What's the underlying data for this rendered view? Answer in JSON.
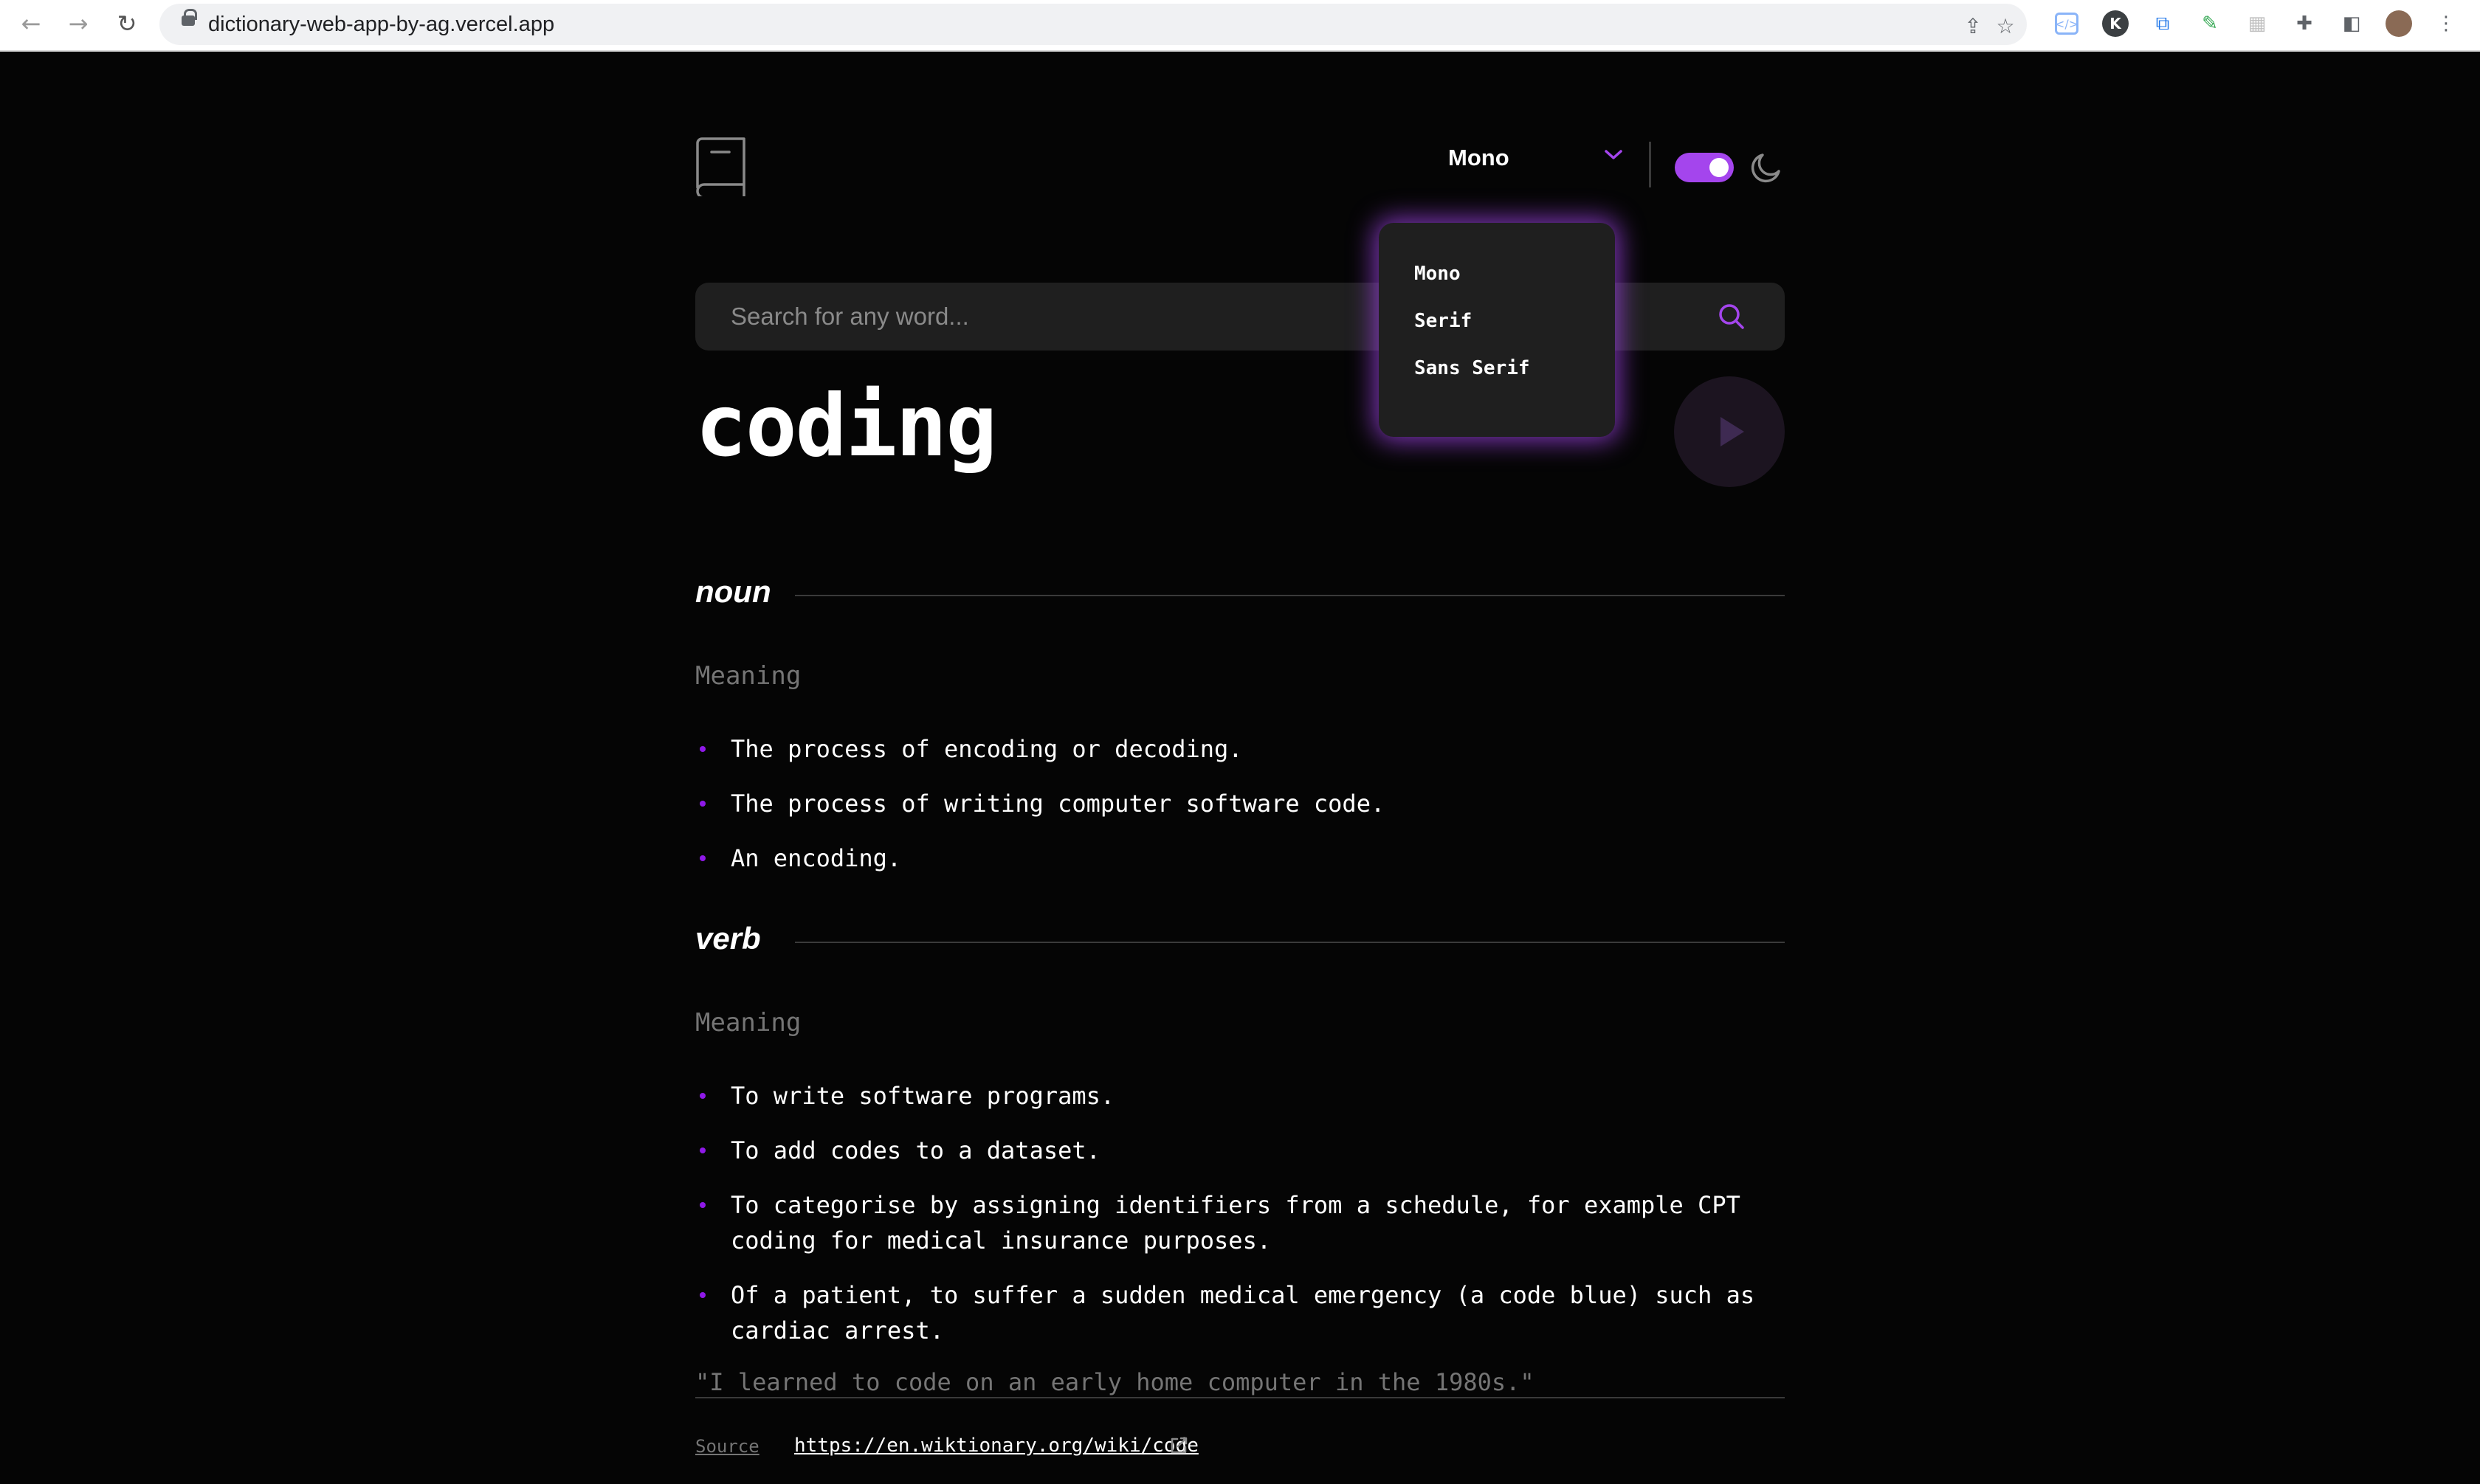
{
  "browser": {
    "url": "dictionary-web-app-by-ag.vercel.app"
  },
  "header": {
    "font_selected": "Mono",
    "theme_toggle_on": true
  },
  "font_dropdown": {
    "options": [
      "Mono",
      "Serif",
      "Sans Serif"
    ]
  },
  "search": {
    "placeholder": "Search for any word..."
  },
  "entry": {
    "word": "coding",
    "meanings": [
      {
        "part_of_speech": "noun",
        "label": "Meaning",
        "definitions": [
          "The process of encoding or decoding.",
          "The process of writing computer software code.",
          "An encoding."
        ]
      },
      {
        "part_of_speech": "verb",
        "label": "Meaning",
        "definitions": [
          "To write software programs.",
          "To add codes to a dataset.",
          "To categorise by assigning identifiers from a schedule, for example CPT coding for medical insurance purposes.",
          "Of a patient, to suffer a sudden medical emergency (a code blue) such as cardiac arrest."
        ],
        "example": "\"I learned to code on an early home computer in the 1980s.\""
      }
    ]
  },
  "footer": {
    "source_label": "Source",
    "source_url": "https://en.wiktionary.org/wiki/code"
  },
  "colors": {
    "accent": "#a445ed",
    "background": "#050505",
    "surface": "#1f1f1f",
    "muted_text": "#757575"
  }
}
